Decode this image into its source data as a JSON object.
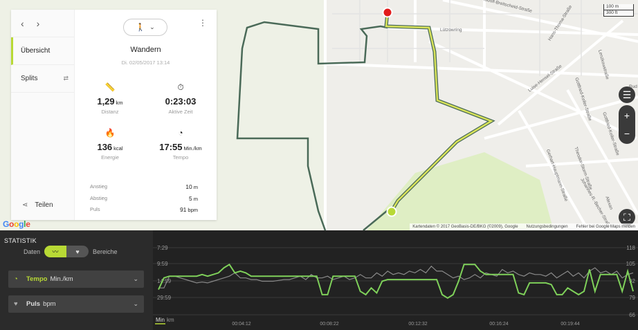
{
  "panel": {
    "nav_prev": "‹",
    "nav_next": "›",
    "nav_items": [
      {
        "label": "Übersicht",
        "active": true
      },
      {
        "label": "Splits",
        "active": false
      }
    ],
    "share_label": "Teilen",
    "activity_type": "Wandern",
    "activity_date": "Di. 02/05/2017 13:14",
    "stats": {
      "distance": {
        "value": "1,29",
        "unit": "km",
        "label": "Distanz"
      },
      "active_time": {
        "value": "0:23:03",
        "label": "Aktive Zeit"
      },
      "energy": {
        "value": "136",
        "unit": "kcal",
        "label": "Energie"
      },
      "pace": {
        "value": "17:55",
        "unit": "Min./km",
        "label": "Tempo"
      }
    },
    "details": [
      {
        "label": "Anstieg",
        "value": "10",
        "unit": "m"
      },
      {
        "label": "Abstieg",
        "value": "5",
        "unit": "m"
      },
      {
        "label": "Puls",
        "value": "91",
        "unit": "bpm"
      }
    ]
  },
  "map": {
    "streets": [
      "Rudolf-Breitscheid-Straße",
      "Lützowring",
      "Hans-Thoma-Straße",
      "Lenzkowstraße",
      "Luise-Hensel-Straße",
      "Gottfried-Keller-Straße",
      "Gottfried-Keller-Straße",
      "Gerhart-Hauptmann-Straße",
      "Theodor-Storm-Straße",
      "Johannes-R.-Becher-Straße",
      "Alexan",
      "Rud"
    ],
    "scale_top": "100 m",
    "scale_bottom": "300 ft",
    "logo": "Google",
    "footer": [
      "Kartendaten © 2017 GeoBasis-DE/BKG (©2009), Google",
      "Nutzungsbedingungen",
      "Fehler bei Google Maps melden"
    ]
  },
  "statistics": {
    "title": "STATISTIK",
    "tab_data": "Daten",
    "tab_zones": "Bereiche",
    "dropdowns": [
      {
        "name": "Tempo",
        "unit": "Min./km",
        "color": "#b8d935"
      },
      {
        "name": "Puls",
        "unit": "bpm",
        "color": "#dddddd"
      }
    ]
  },
  "chart_data": {
    "type": "line",
    "x_ticks": [
      "00:04:12",
      "00:08:22",
      "00:12:32",
      "00:16:24",
      "00:19:44"
    ],
    "x_unit_left": "Min",
    "x_unit_right": "km",
    "y_left_ticks": [
      "7:29",
      "9:59",
      "14:59",
      "29:59"
    ],
    "y_right_ticks": [
      "118",
      "105",
      "92",
      "79",
      "66"
    ],
    "series": [
      {
        "name": "Tempo",
        "color": "#7fd15a",
        "values": [
          1.5,
          2.2,
          2.3,
          2.3,
          2.3,
          2.3,
          2.3,
          2.3,
          2.4,
          2.3,
          2.4,
          2.5,
          2.8,
          3.0,
          2.5,
          2.6,
          2.5,
          2.3,
          2.3,
          2.3,
          2.3,
          2.3,
          2.3,
          2.3,
          2.3,
          2.3,
          2.3,
          2.3,
          2.3,
          2.3,
          1.2,
          1.2,
          2.3,
          2.3,
          2.3,
          2.3,
          2.3,
          1.4,
          1.2,
          1.6,
          1.3,
          2.0,
          2.1,
          2.1,
          2.1,
          2.1,
          2.1,
          2.1,
          2.1,
          2.1,
          2.1,
          2.1,
          1.2,
          1.0,
          1.2,
          2.0,
          3.0,
          3.0,
          3.0,
          2.6,
          2.4,
          2.4,
          2.4,
          2.4,
          2.4,
          2.4,
          1.3,
          1.2,
          1.9,
          1.9,
          1.9,
          1.9,
          1.8,
          1.2,
          1.2,
          1.6,
          1.4,
          1.2,
          1.4,
          2.7,
          1.4,
          2.4,
          2.4,
          2.4,
          2.4,
          1.4,
          2.6,
          1.4
        ]
      },
      {
        "name": "Puls",
        "color": "#8a8a8a",
        "values": [
          1.6,
          1.6,
          2.3,
          2.3,
          2.2,
          2.1,
          2.0,
          1.9,
          1.95,
          1.9,
          2.0,
          2.1,
          2.2,
          2.3,
          2.5,
          2.2,
          2.2,
          2.1,
          2.1,
          2.0,
          2.0,
          2.0,
          2.05,
          2.1,
          2.1,
          2.2,
          2.3,
          2.1,
          2.4,
          2.2,
          2.2,
          2.3,
          2.1,
          2.2,
          2.3,
          2.1,
          2.2,
          2.4,
          2.2,
          2.2,
          2.5,
          2.3,
          2.6,
          2.4,
          2.5,
          2.4,
          2.6,
          2.5,
          2.7,
          2.5,
          2.9,
          2.6,
          2.6,
          2.4,
          2.2,
          2.3,
          2.1,
          2.2,
          2.4,
          2.2,
          2.5,
          2.4,
          2.3,
          2.7,
          2.5,
          2.6,
          2.4,
          2.3,
          2.5,
          2.4,
          2.4,
          2.3,
          2.5,
          2.2,
          2.4,
          2.6,
          2.3,
          2.5,
          2.2,
          2.6,
          2.8,
          2.5,
          2.6,
          2.4,
          2.6,
          2.2,
          2.4,
          2.5
        ]
      }
    ]
  }
}
